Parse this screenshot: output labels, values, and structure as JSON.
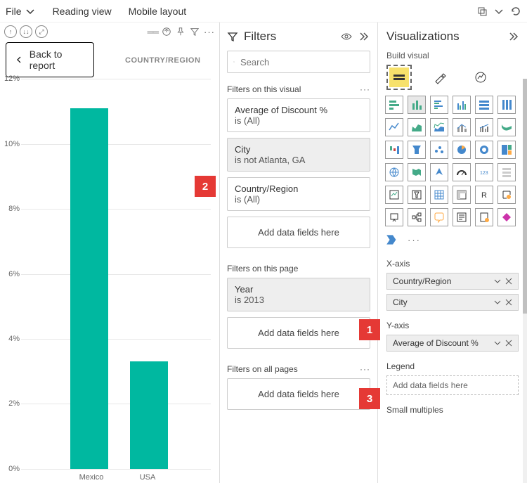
{
  "ribbon": {
    "file": "File",
    "reading_view": "Reading view",
    "mobile_layout": "Mobile layout"
  },
  "canvas": {
    "back_label": "Back to report",
    "truncated_header": "COUNTRY/REGION"
  },
  "chart_data": {
    "type": "bar",
    "categories": [
      "Mexico",
      "USA"
    ],
    "values": [
      11.1,
      3.3
    ],
    "ylim": [
      0,
      12
    ],
    "yticks": [
      "0%",
      "2%",
      "4%",
      "6%",
      "8%",
      "10%",
      "12%"
    ],
    "title": "",
    "xlabel": "",
    "ylabel": ""
  },
  "filters_pane": {
    "title": "Filters",
    "search_placeholder": "Search",
    "sections": {
      "visual": {
        "title": "Filters on this visual",
        "cards": [
          {
            "name": "Average of Discount %",
            "cond": "is (All)",
            "active": false
          },
          {
            "name": "City",
            "cond": "is not Atlanta, GA",
            "active": true
          },
          {
            "name": "Country/Region",
            "cond": "is (All)",
            "active": false
          }
        ],
        "drop": "Add data fields here"
      },
      "page": {
        "title": "Filters on this page",
        "cards": [
          {
            "name": "Year",
            "cond": "is 2013",
            "active": true
          }
        ],
        "drop": "Add data fields here"
      },
      "all": {
        "title": "Filters on all pages",
        "drop": "Add data fields here"
      }
    }
  },
  "viz_pane": {
    "title": "Visualizations",
    "subtitle": "Build visual",
    "field_sections": {
      "xaxis": {
        "label": "X-axis",
        "fields": [
          "Country/Region",
          "City"
        ]
      },
      "yaxis": {
        "label": "Y-axis",
        "fields": [
          "Average of Discount %"
        ]
      },
      "legend": {
        "label": "Legend",
        "drop": "Add data fields here"
      },
      "small_multiples": {
        "label": "Small multiples"
      }
    }
  },
  "callouts": {
    "1": "1",
    "2": "2",
    "3": "3"
  }
}
